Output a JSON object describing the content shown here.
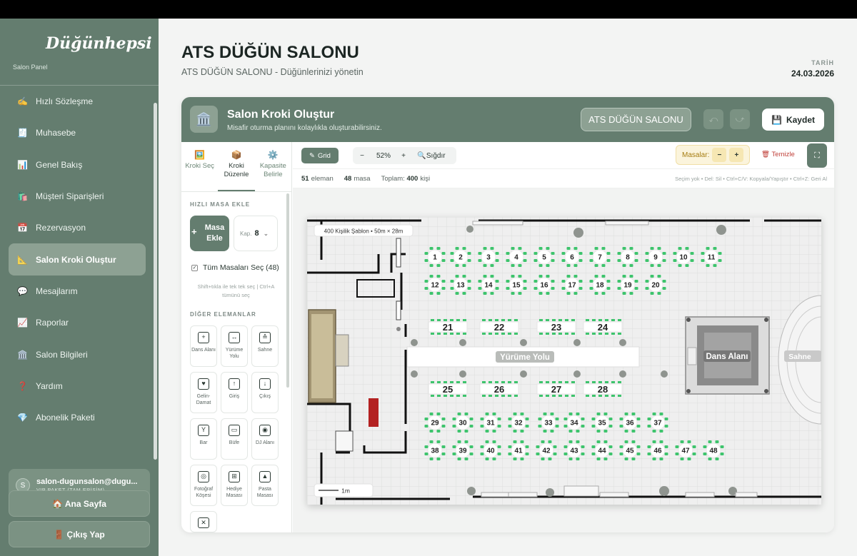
{
  "sidebar": {
    "logo": "Düğünhepsi",
    "panel_label": "Salon Panel",
    "items": [
      {
        "label": "Hızlı Sözleşme",
        "icon": "✍️"
      },
      {
        "label": "Muhasebe",
        "icon": "🧾"
      },
      {
        "label": "Genel Bakış",
        "icon": "📊"
      },
      {
        "label": "Müşteri Siparişleri",
        "icon": "🛍️"
      },
      {
        "label": "Rezervasyon",
        "icon": "📅"
      },
      {
        "label": "Salon Kroki Oluştur",
        "icon": "📐"
      },
      {
        "label": "Mesajlarım",
        "icon": "💬"
      },
      {
        "label": "Raporlar",
        "icon": "📈"
      },
      {
        "label": "Salon Bilgileri",
        "icon": "🏛️"
      },
      {
        "label": "Yardım",
        "icon": "❓"
      },
      {
        "label": "Abonelik Paketi",
        "icon": "💎"
      }
    ],
    "active_index": 5,
    "user": {
      "initial": "S",
      "email": "salon-dugunsalon@dugu...",
      "plan": "VIP PAKET (TAM ERİŞİM)"
    },
    "home_button": "🏠 Ana Sayfa",
    "logout_button": "🚪 Çıkış Yap"
  },
  "header": {
    "title": "ATS DÜĞÜN SALONU",
    "subtitle": "ATS DÜĞÜN SALONU - Düğünlerinizi yönetin",
    "date_label": "TARİH",
    "date_value": "24.03.2026"
  },
  "editor": {
    "title": "Salon Kroki Oluştur",
    "subtitle": "Misafir oturma planını kolaylıkla oluşturabilirsiniz.",
    "salon_button": "ATS DÜĞÜN SALONU",
    "undo_icon": "⤺",
    "redo_icon": "⤻",
    "save_button": "Kaydet",
    "tabs": [
      {
        "label": "Kroki Seç",
        "icon": "🖼️"
      },
      {
        "label": "Kroki Düzenle",
        "icon": "📦"
      },
      {
        "label": "Kapasite Belirle",
        "icon": "⚙️"
      }
    ],
    "quick_add_title": "HIZLI MASA EKLE",
    "add_table_button": "Masa Ekle",
    "capacity_label": "Kap.",
    "capacity_value": "8",
    "select_all": "Tüm Masaları Seç (48)",
    "select_hint": "Shift+tıkla ile tek tek seç | Ctrl+A tümünü seç",
    "other_elements_title": "DİĞER ELEMANLAR",
    "elements": [
      {
        "label": "Dans Alanı",
        "icon": "+"
      },
      {
        "label": "Yürüme Yolu",
        "icon": "↔"
      },
      {
        "label": "Sahne",
        "icon": "≙"
      },
      {
        "label": "Gelin-Damat",
        "icon": "♥"
      },
      {
        "label": "Giriş",
        "icon": "↑"
      },
      {
        "label": "Çıkış",
        "icon": "↓"
      },
      {
        "label": "Bar",
        "icon": "Y"
      },
      {
        "label": "Büfe",
        "icon": "▭"
      },
      {
        "label": "DJ Alanı",
        "icon": "◉"
      },
      {
        "label": "Fotoğraf Köşesi",
        "icon": "◎"
      },
      {
        "label": "Hediye Masası",
        "icon": "⊞"
      },
      {
        "label": "Pasta Masası",
        "icon": "▲"
      },
      {
        "label": "",
        "icon": "✕"
      }
    ],
    "toolbar": {
      "grid": "Grid",
      "zoom_minus": "−",
      "zoom": "52%",
      "zoom_plus": "+",
      "fit": "Sığdır",
      "tables_label": "Masalar:",
      "tables_minus": "−",
      "tables_plus": "+",
      "clear": "Temizle"
    },
    "stats": {
      "elements_count": "51",
      "elements_label": "eleman",
      "tables_count": "48",
      "tables_label": "masa",
      "total_label": "Toplam:",
      "total_value": "400",
      "total_unit": "kişi",
      "shortcuts": "Seçim yok • Del: Sil • Ctrl+C/V: Kopyala/Yapıştır • Ctrl+Z: Geri Al"
    },
    "plan": {
      "template_label": "400 Kişilik Şablon • 50m × 28m",
      "walkway": "Yürüme Yolu",
      "dance_floor": "Dans Alanı",
      "stage": "Sahne",
      "scale": "1m",
      "round_tables": [
        "1",
        "2",
        "3",
        "4",
        "5",
        "6",
        "7",
        "8",
        "9",
        "10",
        "11",
        "12",
        "13",
        "14",
        "15",
        "16",
        "17",
        "18",
        "19",
        "20",
        "29",
        "30",
        "31",
        "32",
        "33",
        "34",
        "35",
        "36",
        "37",
        "38",
        "39",
        "40",
        "41",
        "42",
        "43",
        "44",
        "45",
        "46",
        "47",
        "48"
      ],
      "long_tables": [
        "21",
        "22",
        "23",
        "24",
        "25",
        "26",
        "27",
        "28"
      ]
    },
    "colors": {
      "primary": "#647d6f",
      "table_chair": "#3ec46d",
      "danger": "#c0413a",
      "warning_bg": "#fbf4dc"
    }
  }
}
